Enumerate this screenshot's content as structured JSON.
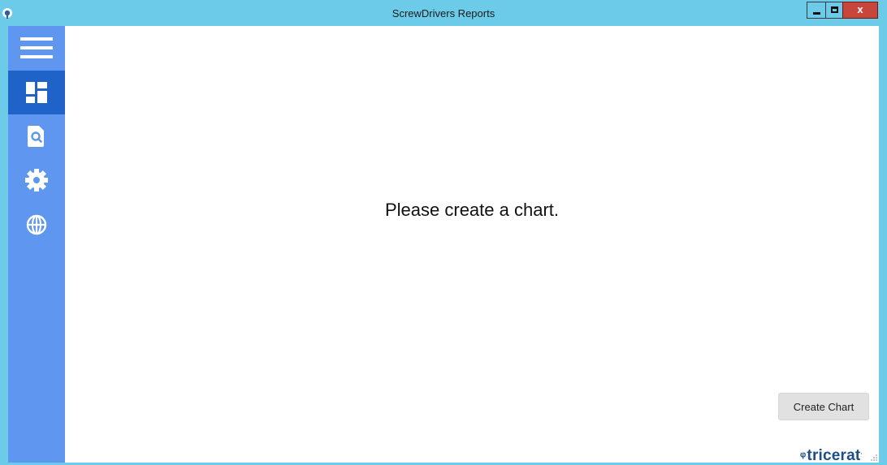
{
  "window": {
    "title": "ScrewDrivers Reports",
    "close_glyph": "x",
    "app_icon": "screwdrivers-logo-icon"
  },
  "sidebar": {
    "items": [
      {
        "id": "menu",
        "icon": "hamburger-menu-icon"
      },
      {
        "id": "dashboard",
        "icon": "dashboard-icon",
        "active": true
      },
      {
        "id": "search-reports",
        "icon": "document-search-icon"
      },
      {
        "id": "settings",
        "icon": "gear-icon"
      },
      {
        "id": "web",
        "icon": "globe-icon"
      }
    ]
  },
  "main": {
    "empty_message": "Please create a chart.",
    "create_chart_label": "Create Chart"
  },
  "brand": {
    "logo_text": "tricerat",
    "logo_mark": "ᵠ",
    "logo_suffix": "."
  },
  "colors": {
    "titlebar": "#6ccbe9",
    "sidebar": "#5e96f0",
    "sidebar_active": "#1f63c9",
    "close_button": "#c8453c",
    "brand": "#1c4f86"
  }
}
